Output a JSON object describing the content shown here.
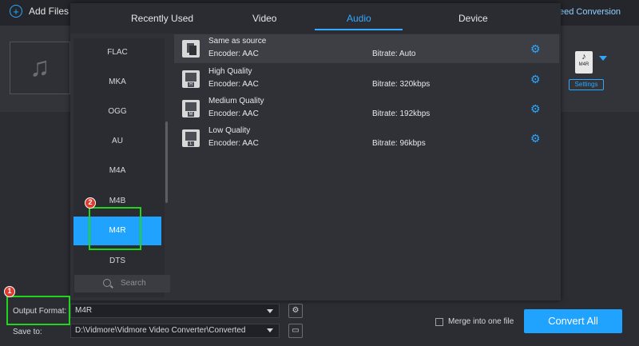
{
  "toolbar": {
    "add_files_label": "Add Files",
    "speed_conversion_label": "eed Conversion"
  },
  "file_item": {
    "format_badge": "M4R",
    "settings_label": "Settings"
  },
  "profile_dialog": {
    "tabs": [
      {
        "label": "Recently Used",
        "active": false
      },
      {
        "label": "Video",
        "active": false
      },
      {
        "label": "Audio",
        "active": true
      },
      {
        "label": "Device",
        "active": false
      }
    ],
    "formats": [
      {
        "label": "FLAC",
        "selected": false
      },
      {
        "label": "MKA",
        "selected": false
      },
      {
        "label": "OGG",
        "selected": false
      },
      {
        "label": "AU",
        "selected": false
      },
      {
        "label": "M4A",
        "selected": false
      },
      {
        "label": "M4B",
        "selected": false
      },
      {
        "label": "M4R",
        "selected": true
      },
      {
        "label": "DTS",
        "selected": false
      }
    ],
    "search_placeholder": "Search",
    "qualities": [
      {
        "name": "Same as source",
        "encoder": "Encoder: AAC",
        "bitrate": "Bitrate: Auto",
        "badge": ""
      },
      {
        "name": "High Quality",
        "encoder": "Encoder: AAC",
        "bitrate": "Bitrate: 320kbps",
        "badge": "H"
      },
      {
        "name": "Medium Quality",
        "encoder": "Encoder: AAC",
        "bitrate": "Bitrate: 192kbps",
        "badge": "M"
      },
      {
        "name": "Low Quality",
        "encoder": "Encoder: AAC",
        "bitrate": "Bitrate: 96kbps",
        "badge": "L"
      }
    ]
  },
  "footer": {
    "output_format_label": "Output Format:",
    "output_format_value": "M4R",
    "save_to_label": "Save to:",
    "save_to_value": "D:\\Vidmore\\Vidmore Video Converter\\Converted",
    "merge_label": "Merge into one file",
    "convert_all_label": "Convert All"
  },
  "annotations": {
    "step1": "1",
    "step2": "2"
  },
  "colors": {
    "accent": "#1fa3ff",
    "highlight_box": "#22d41e",
    "step_badge": "#e03a2e"
  }
}
